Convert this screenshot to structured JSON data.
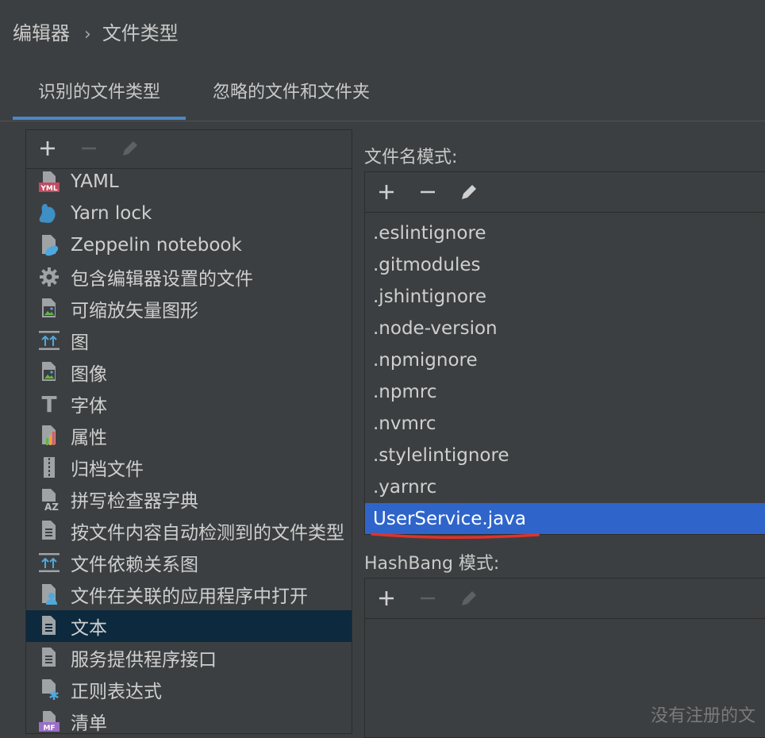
{
  "breadcrumb": {
    "parent": "编辑器",
    "separator": "›",
    "current": "文件类型"
  },
  "tabs": [
    {
      "label": "识别的文件类型",
      "active": true
    },
    {
      "label": "忽略的文件和文件夹",
      "active": false
    }
  ],
  "file_types": [
    {
      "label": "YAML",
      "icon": "yaml-file-icon",
      "icon_text": "YML"
    },
    {
      "label": "Yarn lock",
      "icon": "yarn-icon"
    },
    {
      "label": "Zeppelin notebook",
      "icon": "zeppelin-notebook-icon"
    },
    {
      "label": "包含编辑器设置的文件",
      "icon": "gear-icon"
    },
    {
      "label": "可缩放矢量图形",
      "icon": "svg-image-file-icon"
    },
    {
      "label": "图",
      "icon": "diagram-icon"
    },
    {
      "label": "图像",
      "icon": "image-file-icon"
    },
    {
      "label": "字体",
      "icon": "font-icon",
      "icon_text": "T"
    },
    {
      "label": "属性",
      "icon": "properties-file-icon"
    },
    {
      "label": "归档文件",
      "icon": "archive-file-icon"
    },
    {
      "label": "拼写检查器字典",
      "icon": "dictionary-file-icon",
      "icon_text": "AZ"
    },
    {
      "label": "按文件内容自动检测到的文件类型",
      "icon": "autodetect-file-icon"
    },
    {
      "label": "文件依赖关系图",
      "icon": "dependency-diagram-icon"
    },
    {
      "label": "文件在关联的应用程序中打开",
      "icon": "associated-app-file-icon"
    },
    {
      "label": "文本",
      "icon": "text-file-icon",
      "selected": true
    },
    {
      "label": "服务提供程序接口",
      "icon": "spi-file-icon"
    },
    {
      "label": "正则表达式",
      "icon": "regexp-file-icon"
    },
    {
      "label": "清单",
      "icon": "manifest-file-icon",
      "icon_text": "MF"
    }
  ],
  "filename_patterns": {
    "label": "文件名模式:",
    "items": [
      ".eslintignore",
      ".gitmodules",
      ".jshintignore",
      ".node-version",
      ".npmignore",
      ".npmrc",
      ".nvmrc",
      ".stylelintignore",
      ".yarnrc",
      "UserService.java"
    ],
    "selected_index": 9
  },
  "hashbang_patterns": {
    "label": "HashBang 模式:",
    "items": []
  },
  "footer_hint": "没有注册的文",
  "colors": {
    "background": "#3c3f41",
    "selection": "#2f65ca",
    "tree_selection": "#0d293e",
    "tab_accent": "#4a88c7",
    "annotation": "#e0322c"
  }
}
